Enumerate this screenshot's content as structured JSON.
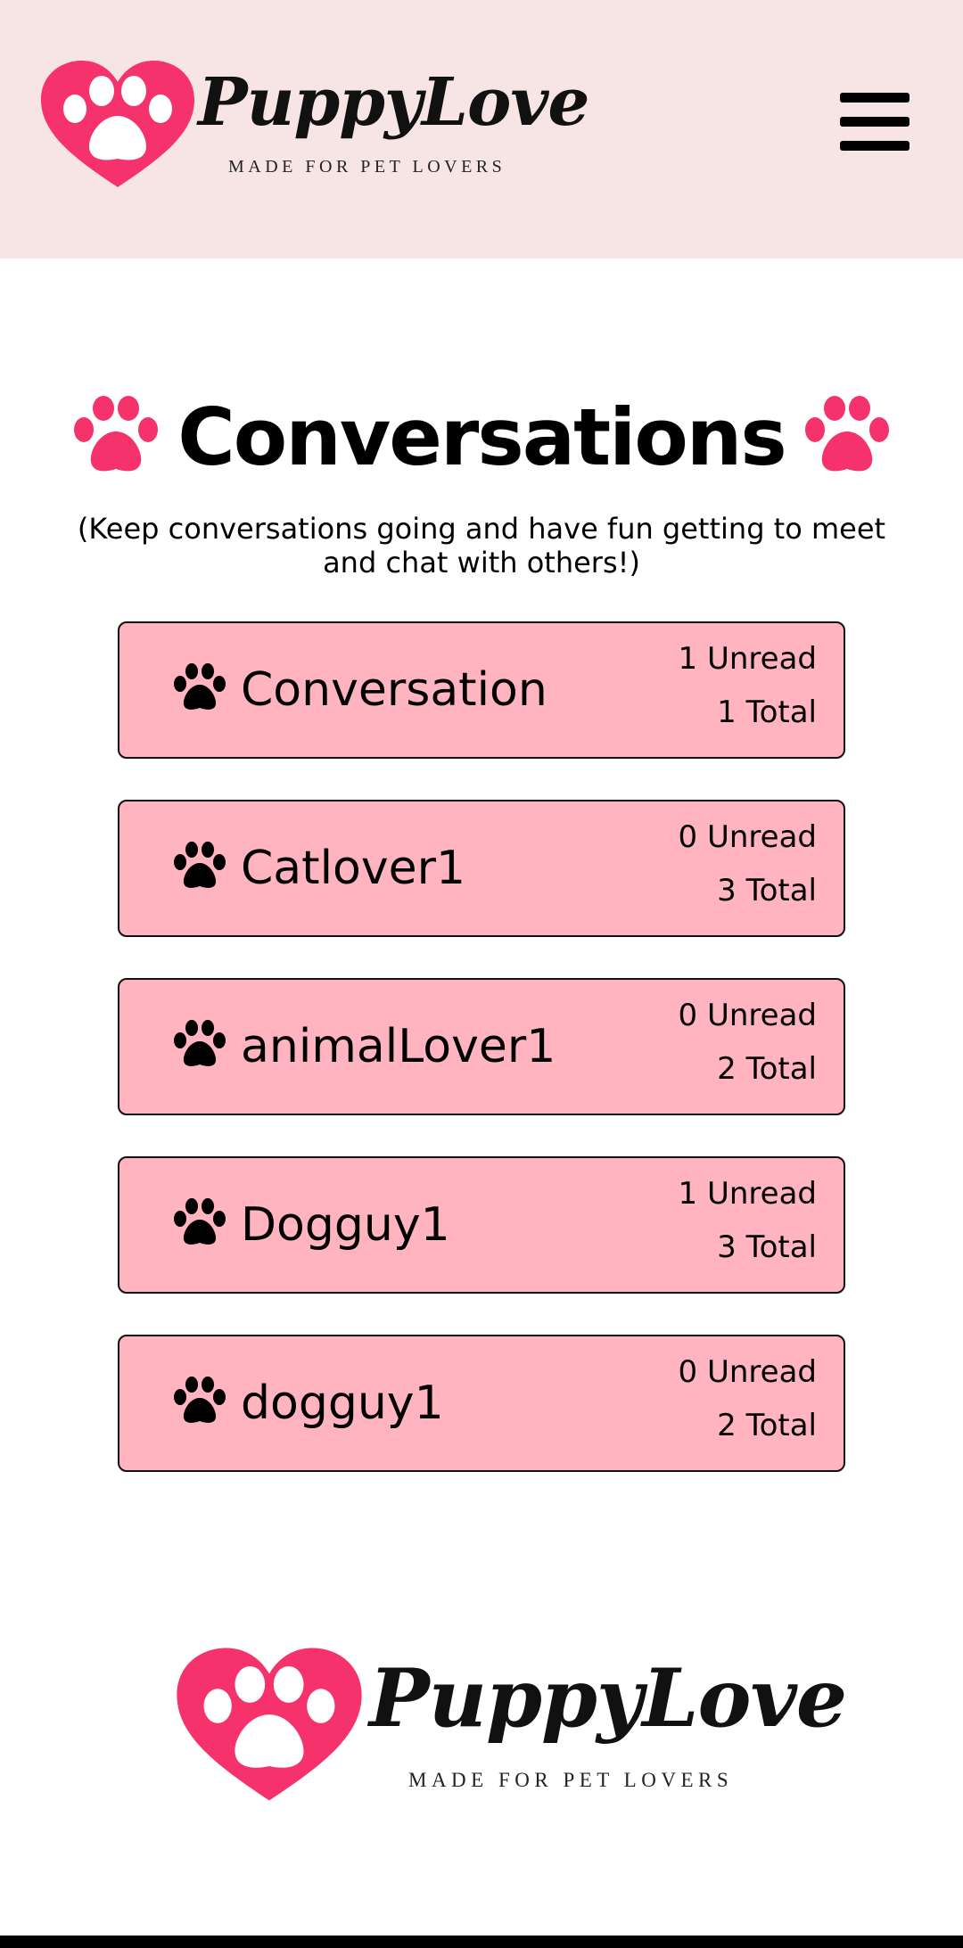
{
  "brand": {
    "name": "PuppyLove",
    "tagline": "MADE FOR PET LOVERS",
    "accent_color": "#f5326b",
    "header_bg": "#f7e5e6",
    "card_bg": "#ffb4c0"
  },
  "header": {
    "menu_icon": "hamburger-menu-icon"
  },
  "page": {
    "title": "Conversations",
    "title_icon": "paw-icon",
    "subtitle": "(Keep conversations going and have fun getting to meet and chat with others!)"
  },
  "conversations": [
    {
      "name": "Conversation",
      "unread": "1 Unread",
      "total": "1 Total"
    },
    {
      "name": "Catlover1",
      "unread": "0 Unread",
      "total": "3 Total"
    },
    {
      "name": "animalLover1",
      "unread": "0 Unread",
      "total": "2 Total"
    },
    {
      "name": "Dogguy1",
      "unread": "1 Unread",
      "total": "3 Total"
    },
    {
      "name": "dogguy1",
      "unread": "0 Unread",
      "total": "2 Total"
    }
  ]
}
